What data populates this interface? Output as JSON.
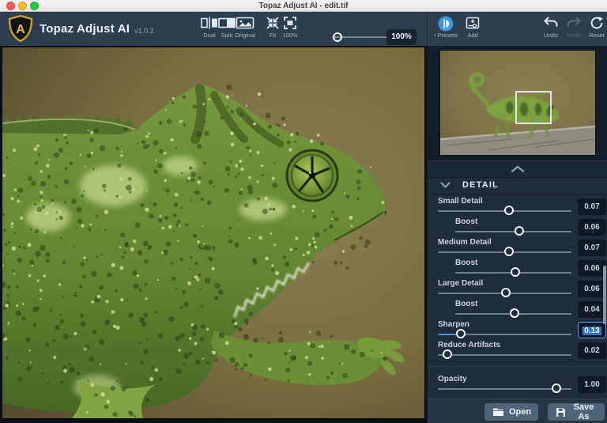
{
  "window": {
    "title": "Topaz Adjust AI - edit.tif",
    "traffic_lights": [
      "close",
      "minimize",
      "zoom"
    ]
  },
  "toolbar": {
    "app_name": "Topaz Adjust AI",
    "version": "v1.0.2",
    "view_modes": [
      {
        "label": "Dual",
        "icon": "dual-view-icon"
      },
      {
        "label": "Split",
        "icon": "split-view-icon"
      },
      {
        "label": "Original",
        "icon": "original-view-icon"
      }
    ],
    "zoom_modes": [
      {
        "label": "Fit",
        "icon": "fit-screen-icon"
      },
      {
        "label": "100%",
        "icon": "actual-size-icon"
      }
    ],
    "zoom_slider_value": "100%",
    "presets": {
      "chevron": "‹",
      "label": "Presets",
      "icon": "presets-icon"
    },
    "add": {
      "label": "Add",
      "icon": "add-adjustment-icon"
    },
    "history": [
      {
        "label": "Undo",
        "icon": "undo-icon",
        "enabled": true
      },
      {
        "label": "Redo",
        "icon": "redo-icon",
        "enabled": false
      },
      {
        "label": "Reset",
        "icon": "reset-icon",
        "enabled": true
      }
    ]
  },
  "panel": {
    "section": {
      "title": "DETAIL",
      "collapse_icon": "chevron-up-icon",
      "expand_icon": "chevron-down-icon"
    },
    "sliders": [
      {
        "label": "Small Detail",
        "value": "0.07",
        "pos": 53,
        "indent": false,
        "fill": false,
        "selected": false
      },
      {
        "label": "Boost",
        "value": "0.06",
        "pos": 55,
        "indent": true,
        "fill": false,
        "selected": false
      },
      {
        "label": "Medium Detail",
        "value": "0.07",
        "pos": 53,
        "indent": false,
        "fill": false,
        "selected": false
      },
      {
        "label": "Boost",
        "value": "0.06",
        "pos": 52,
        "indent": true,
        "fill": false,
        "selected": false
      },
      {
        "label": "Large Detail",
        "value": "0.06",
        "pos": 51,
        "indent": false,
        "fill": false,
        "selected": false
      },
      {
        "label": "Boost",
        "value": "0.04",
        "pos": 51,
        "indent": true,
        "fill": false,
        "selected": false
      },
      {
        "label": "Sharpen",
        "value": "0.13",
        "pos": 17,
        "indent": false,
        "fill": true,
        "selected": true
      },
      {
        "label": "Reduce Artifacts",
        "value": "0.02",
        "pos": 7,
        "indent": false,
        "fill": false,
        "selected": false
      }
    ],
    "opacity": {
      "label": "Opacity",
      "value": "1.00",
      "pos": 89,
      "indent": false,
      "fill": false,
      "selected": false
    },
    "actions": [
      {
        "label": "Open",
        "icon": "folder-open-icon"
      },
      {
        "label": "Save As",
        "icon": "save-icon"
      }
    ]
  },
  "colors": {
    "accent_blue": "#3f97e0",
    "selection_blue": "#2f74c4",
    "toolbar_bg": "#2d3e50",
    "panel_bg": "#1f2d3b",
    "value_box_bg": "#0f1925",
    "action_button_bg": "#4e6579",
    "logo_gold": "#e8b830"
  }
}
